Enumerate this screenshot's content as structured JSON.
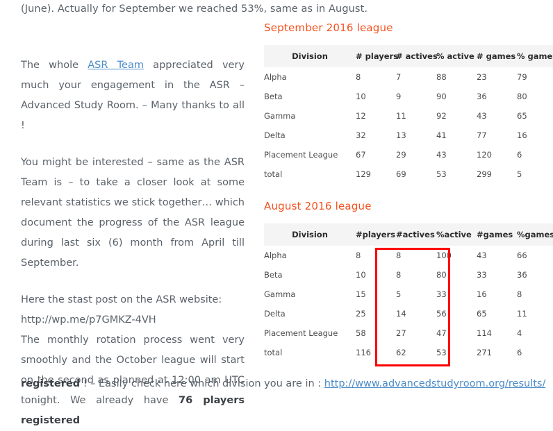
{
  "intro_line": "(June). Actually for September we reached 53%, same as in August.",
  "article": {
    "paragraph_1_before_link": "The whole ",
    "paragraph_1_link": "ASR Team",
    "paragraph_1_after_link": " appreciated very much your engagement in the ASR – Advanced Study Room. – Many thanks to all !",
    "paragraph_2": "You might be interested – same as the ASR Team is – to take a closer look at some relevant statistics we stick together… which document the progress of the ASR league during last six (6) month from April till September.",
    "paragraph_3_line1": "Here the stast post on the ASR website:",
    "paragraph_3_url": "http://wp.me/p7GMKZ-4VH",
    "paragraph_4_part1": "The monthly rotation process went very smoothly and the October league will start on the second as planned at 12:00 am UTC tonight. We already have ",
    "paragraph_4_bold": "76 players registered",
    "paragraph_4_part2": " ! – Easily check here which division you are in : ",
    "paragraph_4_link": "http://www.advancedstudyroom.org/results/"
  },
  "tables": [
    {
      "title": "September 2016 league",
      "headers": [
        "Division",
        "# players",
        "# actives",
        "% active",
        "# games",
        "% games"
      ],
      "rows": [
        [
          "Alpha",
          "8",
          "7",
          "88",
          "23",
          "79"
        ],
        [
          "Beta",
          "10",
          "9",
          "90",
          "36",
          "80"
        ],
        [
          "Gamma",
          "12",
          "11",
          "92",
          "43",
          "65"
        ],
        [
          "Delta",
          "32",
          "13",
          "41",
          "77",
          "16"
        ],
        [
          "Placement League",
          "67",
          "29",
          "43",
          "120",
          "6"
        ],
        [
          "total",
          "129",
          "69",
          "53",
          "299",
          "5"
        ]
      ]
    },
    {
      "title": "August 2016 league",
      "headers": [
        "Division",
        "#players",
        "#actives",
        "%active",
        "#games",
        "%games"
      ],
      "rows": [
        [
          "Alpha",
          "8",
          "8",
          "100",
          "43",
          "66"
        ],
        [
          "Beta",
          "10",
          "8",
          "80",
          "33",
          "36"
        ],
        [
          "Gamma",
          "15",
          "5",
          "33",
          "16",
          "8"
        ],
        [
          "Delta",
          "25",
          "14",
          "56",
          "65",
          "11"
        ],
        [
          "Placement League",
          "58",
          "27",
          "47",
          "114",
          "4"
        ],
        [
          "total",
          "116",
          "62",
          "53",
          "271",
          "6"
        ]
      ]
    }
  ],
  "annotation": {
    "label": "highlight-actives-and-active-percent-columns",
    "color": "#fe0000"
  },
  "colors": {
    "heading": "#f4511e",
    "link": "#4a8bc9",
    "body_text": "#5a6169",
    "table_header_bg": "#f4f4f4",
    "annotation_red": "#fe0000"
  }
}
